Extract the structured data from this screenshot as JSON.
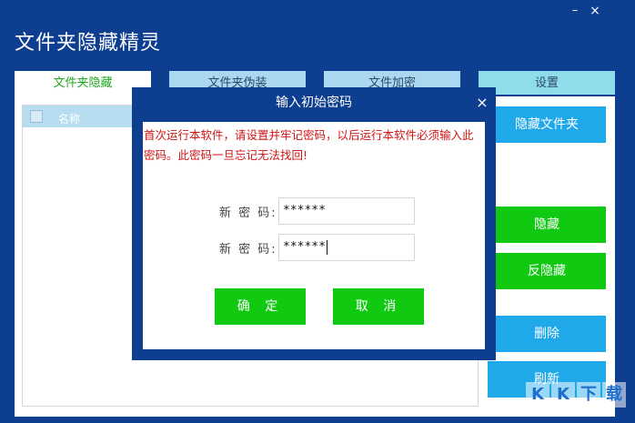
{
  "app": {
    "title": "文件夹隐藏精灵",
    "minimize_glyph": "–",
    "close_glyph": "×"
  },
  "tabs": [
    {
      "label": "文件夹隐藏",
      "active": true
    },
    {
      "label": "文件夹伪装",
      "active": false
    },
    {
      "label": "文件加密",
      "active": false
    },
    {
      "label": "设置",
      "active": false
    }
  ],
  "file_list": {
    "column_name": "名称"
  },
  "side_buttons": {
    "hide_folder": "隐藏文件夹",
    "hide": "隐藏",
    "unhide": "反隐藏",
    "delete": "删除",
    "refresh": "刷新"
  },
  "dialog": {
    "title": "输入初始密码",
    "close_glyph": "×",
    "message": "首次运行本软件，请设置并牢记密码，以后运行本软件必须输入此密码。此密码一旦忘记无法找回!",
    "label_1": "新 密 码:",
    "label_2": "新 密 码:",
    "value_1": "******",
    "value_2": "******",
    "ok": "确 定",
    "cancel": "取 消"
  },
  "watermark": {
    "chars": [
      "K",
      "K",
      "下",
      "载"
    ]
  },
  "colors": {
    "frame": "#0d3e8f",
    "tab_inactive": "#a9d8f0",
    "tab_active_text": "#1ea81e",
    "button_blue": "#1fa8ea",
    "button_green": "#10c910",
    "warning_text": "#d21414"
  }
}
